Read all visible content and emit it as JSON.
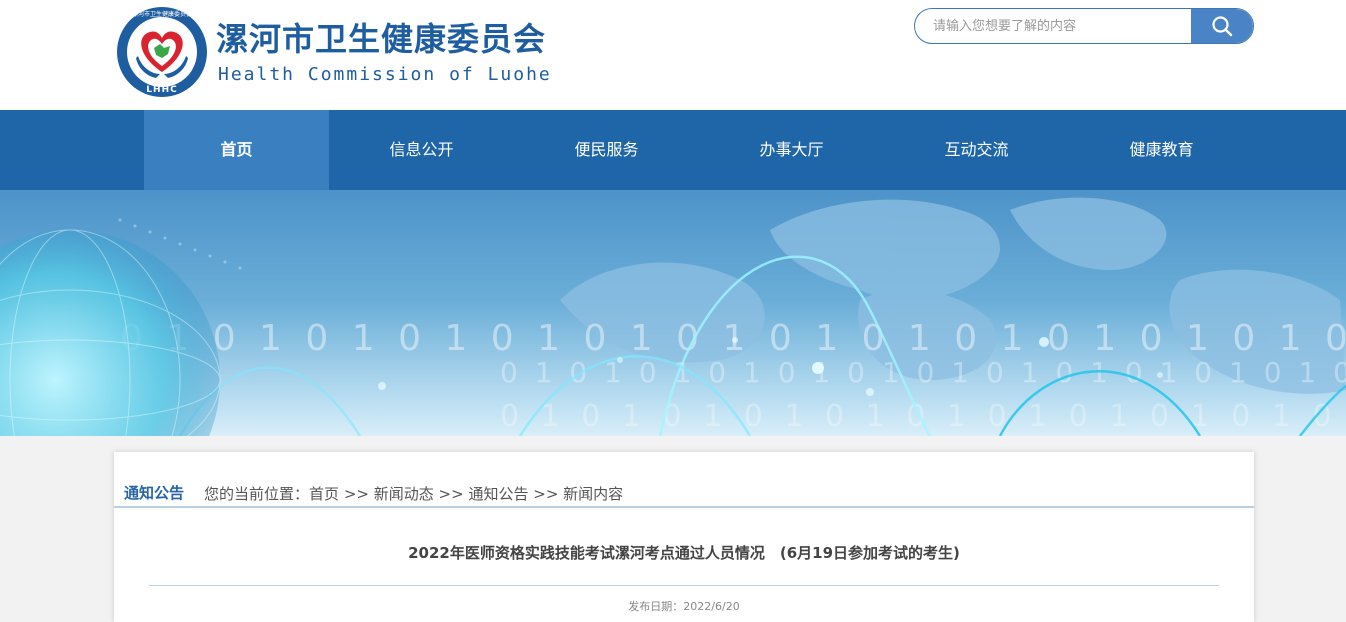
{
  "header": {
    "title": "漯河市卫生健康委员会",
    "subtitle": "Health Commission of Luohe",
    "logo_text": "漯河市卫生健康委员会",
    "logo_abbr": "LHHC"
  },
  "search": {
    "placeholder": "请输入您想要了解的内容",
    "icon": "search-icon"
  },
  "nav": {
    "items": [
      {
        "label": "首页",
        "active": true
      },
      {
        "label": "信息公开",
        "active": false
      },
      {
        "label": "便民服务",
        "active": false
      },
      {
        "label": "办事大厅",
        "active": false
      },
      {
        "label": "互动交流",
        "active": false
      },
      {
        "label": "健康教育",
        "active": false
      }
    ]
  },
  "banner": {
    "binary_text": "0 1 0 1 0 1 0 1 0 1 0 1 0 1 0 1 0 1 0 1 0 1 0 1 0 1 0 1 0 1"
  },
  "content": {
    "section_label": "通知公告",
    "location_prefix": "您的当前位置：",
    "breadcrumb": [
      "首页",
      "新闻动态",
      "通知公告",
      "新闻内容"
    ],
    "separator": ">>",
    "article_title": "2022年医师资格实践技能考试漯河考点通过人员情况　(6月19日参加考试的考生)",
    "publish_date": "发布日期：2022/6/20"
  },
  "colors": {
    "brand_blue": "#1e5da0",
    "nav_bg": "#1f66a8",
    "nav_active": "#3a7fc0",
    "logo_red": "#d9232e",
    "logo_green": "#3aa84a"
  }
}
